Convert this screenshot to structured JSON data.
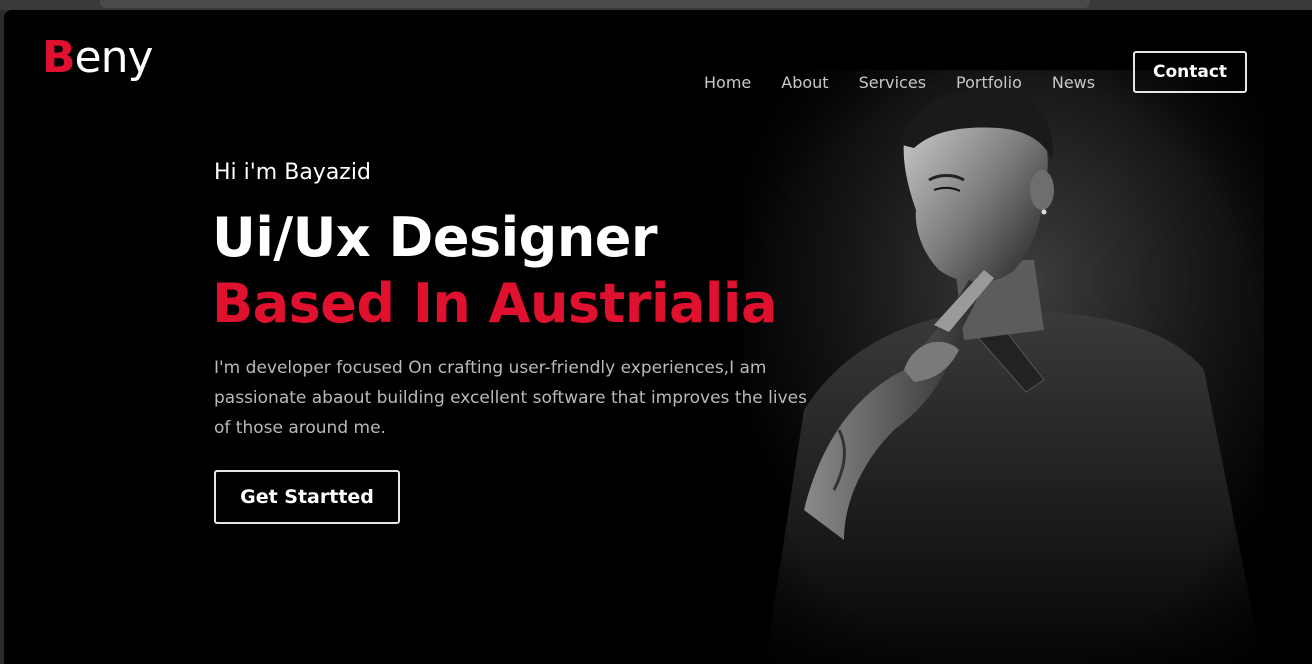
{
  "logo": {
    "first_letter": "B",
    "rest": "eny"
  },
  "nav": {
    "items": [
      {
        "label": "Home"
      },
      {
        "label": "About"
      },
      {
        "label": "Services"
      },
      {
        "label": "Portfolio"
      },
      {
        "label": "News"
      }
    ],
    "contact_label": "Contact"
  },
  "hero": {
    "greeting": "Hi i'm Bayazid",
    "headline_line1": "Ui/Ux Designer",
    "headline_line2": "Based In Austrialia",
    "description": "I'm developer focused On crafting user-friendly experiences,I am passionate abaout building excellent software that improves the lives of those around me.",
    "cta_label": "Get Startted"
  },
  "colors": {
    "background": "#000000",
    "accent": "#e0102f",
    "text_primary": "#ffffff",
    "text_muted": "#b9b9b9"
  }
}
